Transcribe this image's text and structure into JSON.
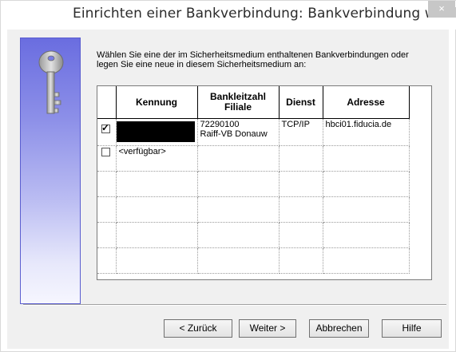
{
  "window": {
    "title": "Einrichten einer Bankverbindung: Bankverbindung wählen",
    "close_symbol": "×"
  },
  "intro_text": "Wählen Sie eine der im Sicherheitsmedium enthaltenen Bankverbindungen oder legen Sie eine neue in diesem Sicherheitsmedium an:",
  "table": {
    "columns": [
      "Kennung",
      "Bankleitzahl Filiale",
      "Dienst",
      "Adresse"
    ],
    "rows": [
      {
        "checked": true,
        "kennung": "",
        "kennung_redacted": true,
        "blz": "72290100",
        "filiale": "Raiff-VB Donauw",
        "dienst": "TCP/IP",
        "adresse": "hbci01.fiducia.de"
      },
      {
        "checked": false,
        "kennung": "<verfügbar>",
        "kennung_redacted": false,
        "blz": "",
        "filiale": "",
        "dienst": "",
        "adresse": ""
      }
    ],
    "check_mark": "✓"
  },
  "buttons": {
    "back": "< Zurück",
    "next": "Weiter >",
    "cancel": "Abbrechen",
    "help": "Hilfe"
  },
  "icons": {
    "side_image": "key-icon",
    "close": "close-icon"
  },
  "colors": {
    "side_gradient_top": "#6a6de0",
    "side_gradient_bottom": "#f6f6fe",
    "dialog_background": "#f0f0f0"
  }
}
